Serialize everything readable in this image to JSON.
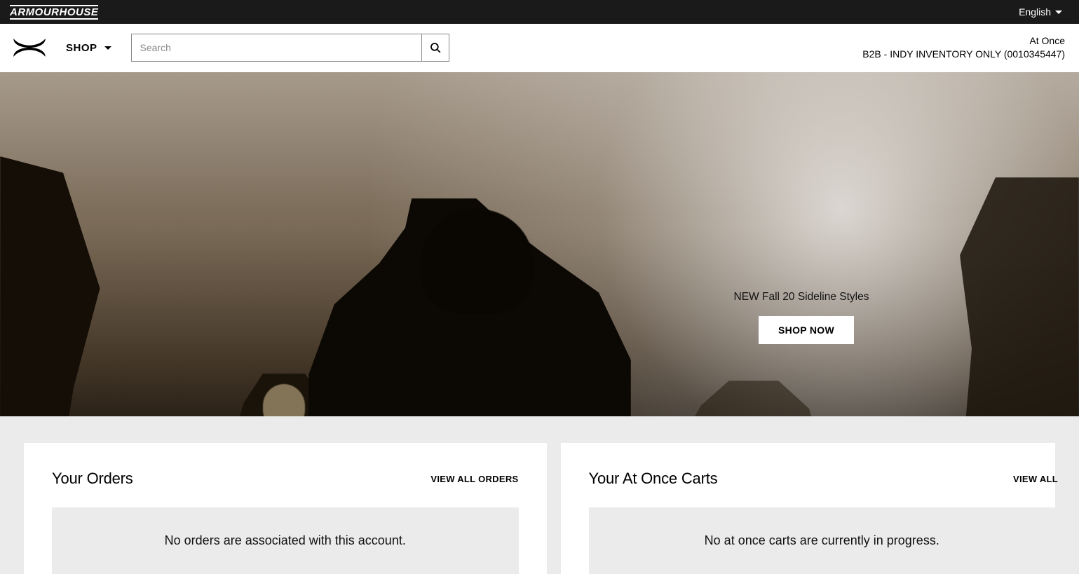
{
  "topbar": {
    "brand": "ARMOURHOUSE",
    "language_label": "English"
  },
  "nav": {
    "shop_label": "SHOP",
    "search_placeholder": "Search",
    "account_line1": "At Once",
    "account_line2": "B2B - INDY INVENTORY ONLY (0010345447)"
  },
  "hero": {
    "headline": "NEW Fall 20 Sideline Styles",
    "button_label": "SHOP NOW"
  },
  "cards": {
    "orders": {
      "title": "Your Orders",
      "link_label": "VIEW ALL ORDERS",
      "empty_message": "No orders are associated with this account."
    },
    "carts": {
      "title": "Your At Once Carts",
      "link_label": "VIEW ALL",
      "empty_message": "No at once carts are currently in progress."
    }
  }
}
